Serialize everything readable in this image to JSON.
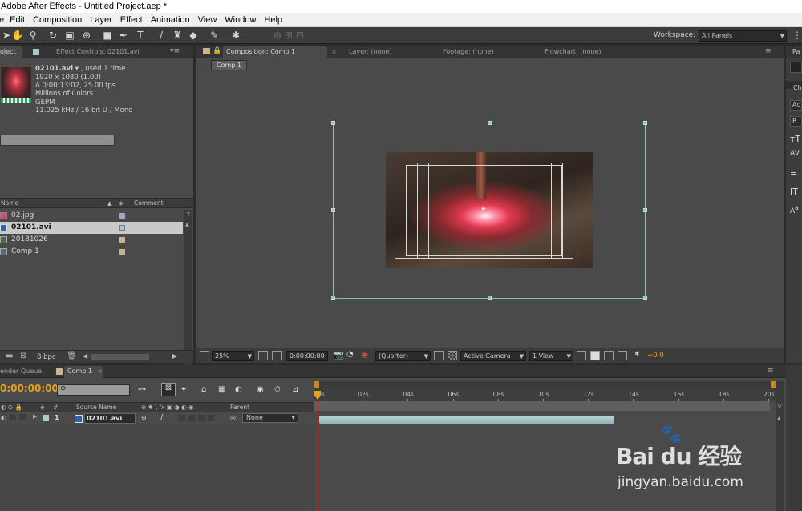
{
  "app": {
    "title": "Adobe After Effects - Untitled Project.aep *",
    "menu": [
      "e",
      "Edit",
      "Composition",
      "Layer",
      "Effect",
      "Animation",
      "View",
      "Window",
      "Help"
    ]
  },
  "toolbar": {
    "tools": [
      "selection-tool",
      "hand-tool",
      "zoom-tool",
      "rotation-tool",
      "camera-tool",
      "pan-behind-tool",
      "rectangle-tool",
      "pen-tool",
      "type-tool",
      "brush-tool",
      "clone-stamp-tool",
      "eraser-tool",
      "roto-brush-tool",
      "puppet-pin-tool"
    ],
    "workspace_label": "Workspace:",
    "workspace_value": "All Panels"
  },
  "project_panel": {
    "tabs": [
      "oject",
      "Effect Controls: 02101.avi"
    ],
    "selected_file": {
      "name": "02101.avi",
      "used": ", used 1 time",
      "resolution": "1920 x 1080 (1.00)",
      "duration": "Δ 0:00:13:02, 25.00 fps",
      "colors": "Millions of Colors",
      "codec": "GEPM",
      "audio": "11.025 kHz / 16 bit U / Mono"
    },
    "columns": {
      "name": "Name",
      "comment": "Comment"
    },
    "items": [
      {
        "label": "02.jpg",
        "kind": "image",
        "swatch": "#a6a6c7",
        "selected": false
      },
      {
        "label": "02101.avi",
        "kind": "video",
        "swatch": "#a9cbcb",
        "selected": true
      },
      {
        "label": "20181026",
        "kind": "folder",
        "swatch": "#c8b68a",
        "selected": false
      },
      {
        "label": "Comp 1",
        "kind": "comp",
        "swatch": "#c8b68a",
        "selected": false
      }
    ],
    "bpc": "8 bpc"
  },
  "composition_panel": {
    "tabs": [
      {
        "label": "Composition: Comp 1",
        "active": true
      },
      {
        "label": "Layer: (none)",
        "active": false
      },
      {
        "label": "Footage: (none)",
        "active": false
      },
      {
        "label": "Flowchart: (none)",
        "active": false
      }
    ],
    "comp_button": "Comp 1",
    "zoom": "25%",
    "timecode": "0:00:00:00",
    "resolution": "(Quarter)",
    "camera": "Active Camera",
    "views": "1 View",
    "exposure": "+0.0"
  },
  "right_panel": {
    "tab": "Pa",
    "labels": [
      "Ch",
      "Ad",
      "R"
    ]
  },
  "timeline": {
    "tabs": [
      {
        "label": "ender Queue",
        "active": false
      },
      {
        "label": "Comp 1",
        "active": true
      }
    ],
    "timecode": "0:00:00:00",
    "search_placeholder": "",
    "columns": {
      "num": "#",
      "source": "Source Name",
      "parent": "Parent"
    },
    "ruler": [
      "0s",
      "02s",
      "04s",
      "06s",
      "08s",
      "10s",
      "12s",
      "14s",
      "16s",
      "18s",
      "20s"
    ],
    "layers": [
      {
        "num": "1",
        "name": "02101.avi",
        "parent": "None"
      }
    ],
    "playhead_seconds": 0,
    "layer_bar": {
      "start_seconds": 0,
      "end_seconds": 13.08,
      "total_seconds": 20
    }
  },
  "watermark": {
    "brand": "Bai du 经验",
    "url": "jingyan.baidu.com"
  },
  "colors": {
    "panel": "#4a4a4a",
    "bounding_box": "#8fbcbc",
    "playhead": "#e5a21c",
    "layer_bar": "#a9c6c6"
  }
}
